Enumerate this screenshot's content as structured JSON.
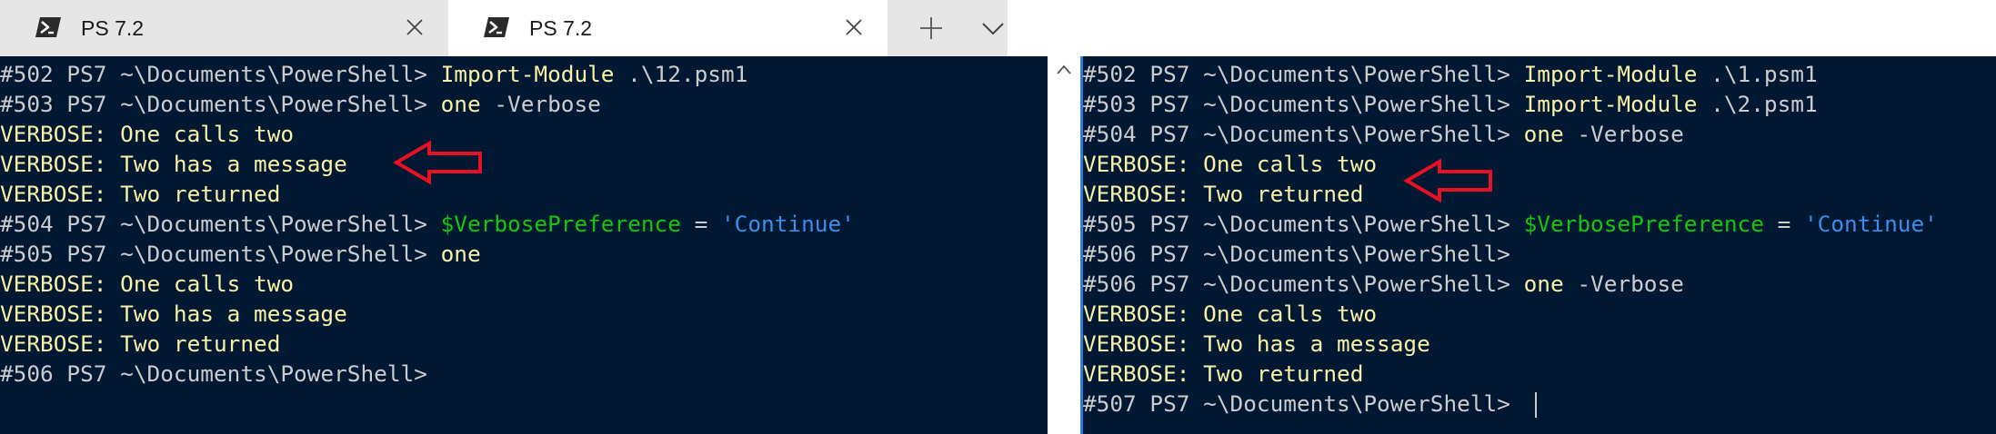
{
  "tabs": [
    {
      "title": "PS 7.2",
      "active": false,
      "icon": "powershell-icon"
    },
    {
      "title": "PS 7.2",
      "active": true,
      "icon": "powershell-icon"
    }
  ],
  "tabbar": {
    "new_tab_icon": "plus-icon",
    "dropdown_icon": "chevron-down-icon"
  },
  "colors": {
    "terminal_bg": "#011833",
    "prompt": "#cccccc",
    "command_yellow": "#f9f1a5",
    "variable_green": "#16c60c",
    "string_blue": "#3b8eea",
    "arrow_red": "#e81123"
  },
  "left_pane": {
    "l1": {
      "prompt": "#502 PS7 ~\\Documents\\PowerShell> ",
      "cmd": "Import-Module",
      "arg": " .\\12.psm1"
    },
    "l2": {
      "prompt": "#503 PS7 ~\\Documents\\PowerShell> ",
      "cmd": "one",
      "arg": " -Verbose"
    },
    "l3": "VERBOSE: One calls two",
    "l4": "VERBOSE: Two has a message",
    "l5": "VERBOSE: Two returned",
    "l6": {
      "prompt": "#504 PS7 ~\\Documents\\PowerShell> ",
      "var": "$VerbosePreference",
      "op": " = ",
      "str": "'Continue'"
    },
    "l7": {
      "prompt": "#505 PS7 ~\\Documents\\PowerShell> ",
      "cmd": "one"
    },
    "l8": "VERBOSE: One calls two",
    "l9": "VERBOSE: Two has a message",
    "l10": "VERBOSE: Two returned",
    "l11": {
      "prompt": "#506 PS7 ~\\Documents\\PowerShell>"
    }
  },
  "right_pane": {
    "l1": {
      "prompt": "#502 PS7 ~\\Documents\\PowerShell> ",
      "cmd": "Import-Module",
      "arg": " .\\1.psm1"
    },
    "l2": {
      "prompt": "#503 PS7 ~\\Documents\\PowerShell> ",
      "cmd": "Import-Module",
      "arg": " .\\2.psm1"
    },
    "l3": {
      "prompt": "#504 PS7 ~\\Documents\\PowerShell> ",
      "cmd": "one",
      "arg": " -Verbose"
    },
    "l4": "VERBOSE: One calls two",
    "l5": "VERBOSE: Two returned",
    "l6": {
      "prompt": "#505 PS7 ~\\Documents\\PowerShell> ",
      "var": "$VerbosePreference",
      "op": " = ",
      "str": "'Continue'"
    },
    "l7": {
      "prompt": "#506 PS7 ~\\Documents\\PowerShell>"
    },
    "l8": {
      "prompt": "#506 PS7 ~\\Documents\\PowerShell> ",
      "cmd": "one",
      "arg": " -Verbose"
    },
    "l9": "VERBOSE: One calls two",
    "l10": "VERBOSE: Two has a message",
    "l11": "VERBOSE: Two returned",
    "l12": {
      "prompt": "#507 PS7 ~\\Documents\\PowerShell> "
    }
  }
}
